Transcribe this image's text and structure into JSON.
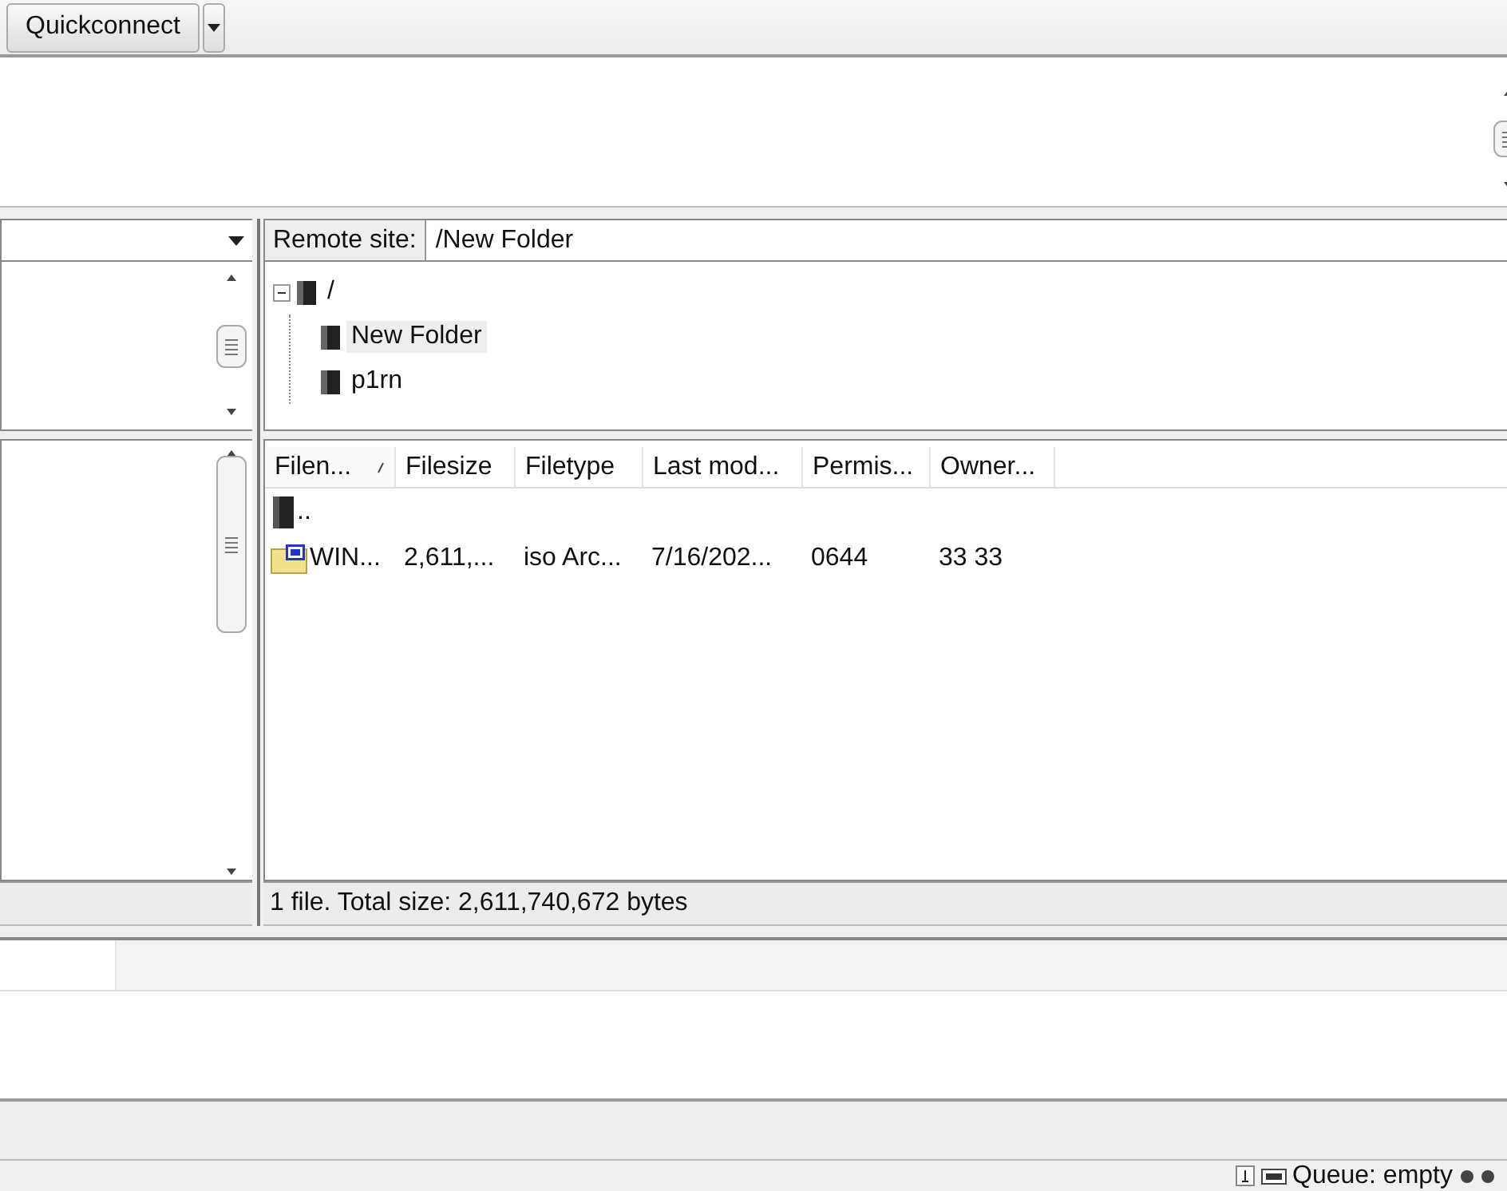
{
  "toolbar": {
    "quickconnect": "Quickconnect"
  },
  "remote_site": {
    "label": "Remote site:",
    "path": "/New Folder"
  },
  "remote_tree": [
    {
      "name": "/",
      "expanded": true,
      "selected": false,
      "children": [
        {
          "name": "New Folder",
          "selected": true
        },
        {
          "name": "p1rn",
          "selected": false
        }
      ]
    }
  ],
  "remote_files": {
    "columns": [
      {
        "label": "Filen...",
        "sorted": true
      },
      {
        "label": "Filesize",
        "sorted": false
      },
      {
        "label": "Filetype",
        "sorted": false
      },
      {
        "label": "Last mod...",
        "sorted": false
      },
      {
        "label": "Permis...",
        "sorted": false
      },
      {
        "label": "Owner...",
        "sorted": false
      }
    ],
    "rows": [
      {
        "kind": "parent",
        "cells": [
          ".."
        ]
      },
      {
        "kind": "iso",
        "cells": [
          "WIN...",
          "2,611,...",
          "iso Arc...",
          "7/16/202...",
          "0644",
          "33 33"
        ]
      }
    ]
  },
  "remote_status": "1 file. Total size: 2,611,740,672 bytes",
  "status_bar": {
    "queue": "Queue: empty"
  }
}
